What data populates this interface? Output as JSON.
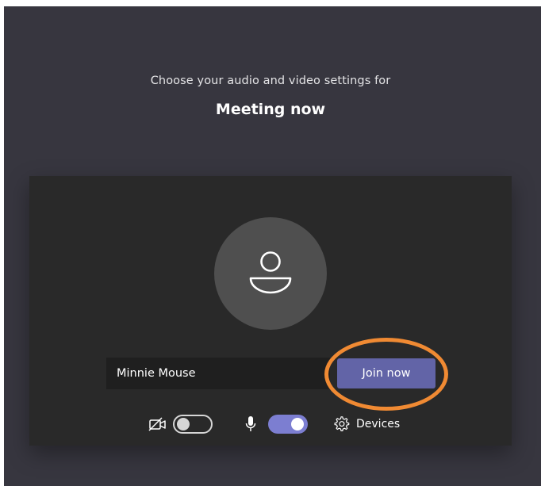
{
  "prejoin": {
    "subtitle": "Choose your audio and video settings for",
    "meeting_title": "Meeting now"
  },
  "user": {
    "display_name": "Minnie Mouse"
  },
  "actions": {
    "join_label": "Join now",
    "devices_label": "Devices"
  },
  "controls": {
    "camera_enabled": false,
    "microphone_enabled": true
  },
  "icons": {
    "camera": "camera-off-icon",
    "microphone": "microphone-icon",
    "devices": "gear-icon",
    "avatar": "person-icon"
  },
  "colors": {
    "background": "#37363f",
    "panel": "#292929",
    "accent": "#6264a7",
    "toggle_on": "#7c7ed1",
    "highlight": "#f08a33"
  }
}
